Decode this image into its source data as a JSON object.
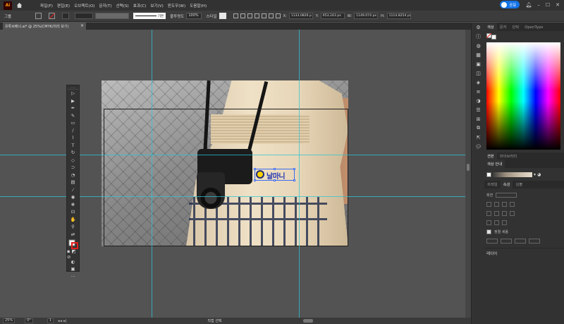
{
  "app": {
    "logo": "Ai"
  },
  "menu": [
    "파일(F)",
    "편집(E)",
    "오브젝트(O)",
    "문자(T)",
    "선택(S)",
    "효과(C)",
    "보기(V)",
    "윈도우(W)",
    "도움말(H)"
  ],
  "share": {
    "label": "공유"
  },
  "control_bar": {
    "group_label": "그룹",
    "stroke_label": "기본",
    "opacity_label": "불투명도",
    "opacity_value": "100%",
    "style_label": "스타일",
    "x": "1133.0826 p",
    "y": "653.243 px",
    "w": "1149.074 px",
    "h": "1114.8254 px"
  },
  "document": {
    "tab_title": "유튜브배너.ai* @ 25%(CMYK/미리 보기)"
  },
  "canvas": {
    "logo_text": "날마니"
  },
  "status_bar": {
    "zoom": "25%",
    "artboard": "1",
    "mode": "직접 선택"
  },
  "panels": {
    "top_tabs": [
      "색상",
      "문자",
      "단락",
      "OpenType"
    ],
    "mid_tabs": [
      "견본",
      "라이브러리"
    ],
    "color_guide_title": "색상 안내",
    "sub_tabs": [
      "프레임",
      "속성",
      "심볼"
    ],
    "props_label": "회전",
    "artboards_label": "정렬 세움",
    "layers_label": "레이어"
  },
  "colors": {
    "accent": "#1473e6",
    "guide": "#2ec4d6",
    "selection": "#3d6cf0"
  },
  "icons": [
    "home-icon",
    "search-icon",
    "bell-icon",
    "settings-icon",
    "close-icon"
  ]
}
